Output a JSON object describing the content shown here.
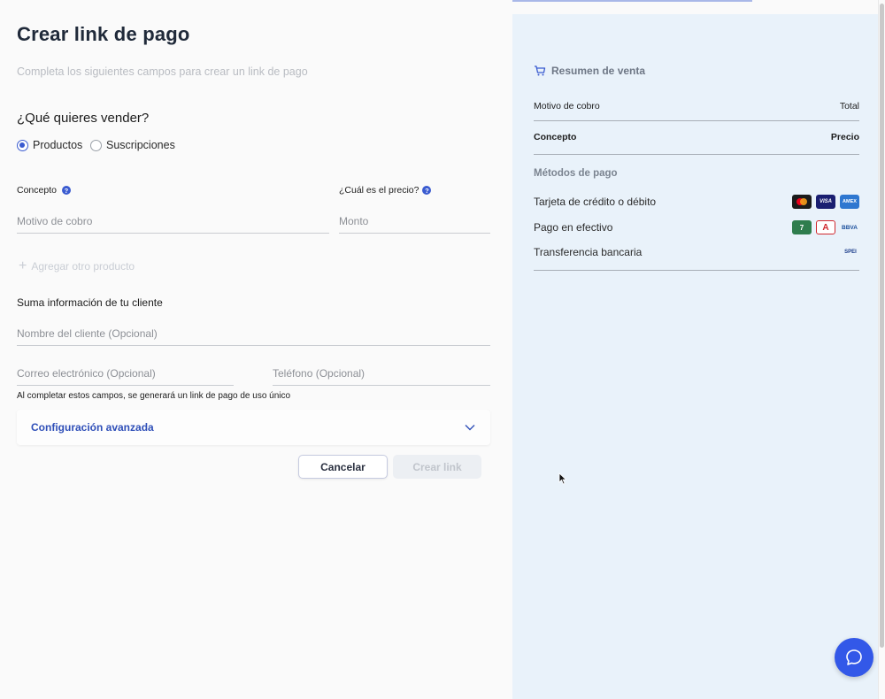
{
  "form": {
    "title": "Crear link de pago",
    "subtitle": "Completa los siguientes campos para crear un link de pago",
    "question": "¿Qué quieres vender?",
    "options": [
      {
        "label": "Productos",
        "selected": true
      },
      {
        "label": "Suscripciones",
        "selected": false
      }
    ],
    "concept_label": "Concepto",
    "concept_placeholder": "Motivo de cobro",
    "price_label": "¿Cuál es el precio?",
    "price_placeholder": "Monto",
    "add_product": "Agregar otro producto",
    "client_section": "Suma información de tu cliente",
    "client_name_placeholder": "Nombre del cliente (Opcional)",
    "email_placeholder": "Correo electrónico (Opcional)",
    "phone_placeholder": "Teléfono (Opcional)",
    "hint": "Al completar estos campos, se generará un link de pago de uso único",
    "advanced": "Configuración avanzada",
    "cancel": "Cancelar",
    "create": "Crear link"
  },
  "summary": {
    "title": "Resumen de venta",
    "reason_label": "Motivo de cobro",
    "total_label": "Total",
    "concept_header": "Concepto",
    "price_header": "Precio",
    "methods_title": "Métodos de pago",
    "methods": [
      {
        "label": "Tarjeta de crédito o débito",
        "logos": [
          "Mastercard",
          "VISA",
          "AMEX"
        ]
      },
      {
        "label": "Pago en efectivo",
        "logos": [
          "7",
          "A",
          "BBVA"
        ]
      },
      {
        "label": "Transferencia bancaria",
        "logos": [
          "SPEI"
        ]
      }
    ]
  },
  "icons": {
    "cart": "cart-icon",
    "help": "help-icon",
    "chevron": "chevron-down-icon",
    "chat": "chat-icon"
  },
  "colors": {
    "accent": "#3358e8",
    "link": "#2f4fb8",
    "summary_bg": "#e9f2fa"
  }
}
